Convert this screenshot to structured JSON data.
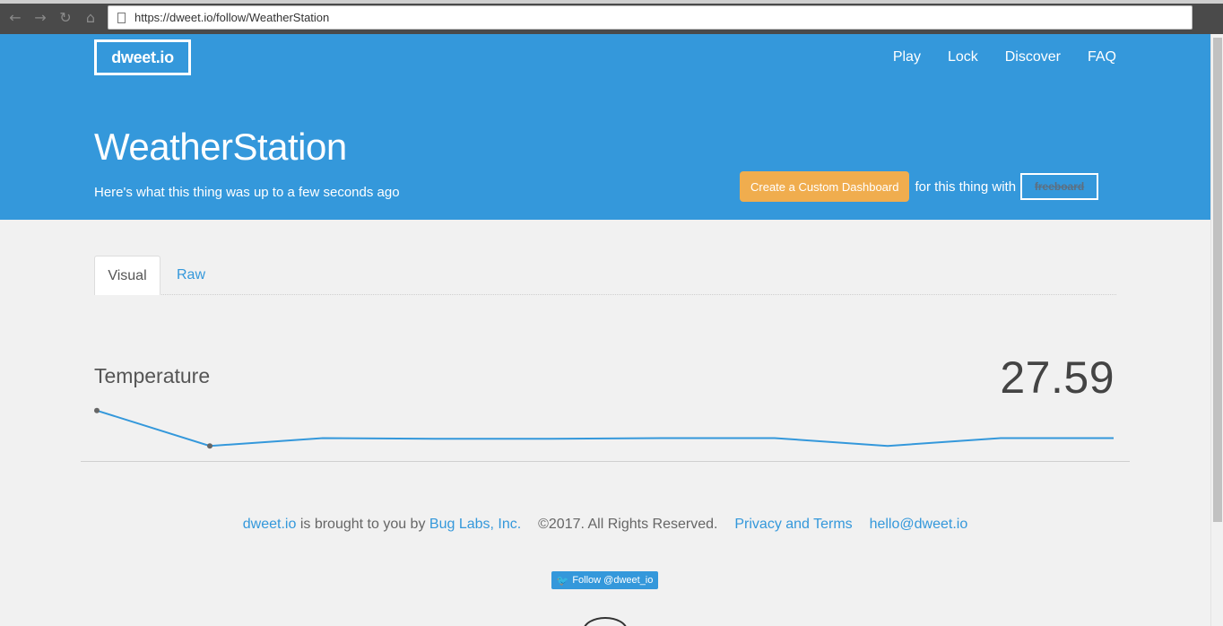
{
  "browser": {
    "url": "https://dweet.io/follow/WeatherStation"
  },
  "header": {
    "logo": "dweet.io",
    "nav": [
      {
        "label": "Play"
      },
      {
        "label": "Lock"
      },
      {
        "label": "Discover"
      },
      {
        "label": "FAQ"
      }
    ],
    "title": "WeatherStation",
    "subtitle": "Here's what this thing was up to a few seconds ago",
    "dashboard_button": "Create a Custom Dashboard",
    "dashboard_with": "for this thing with",
    "freeboard_label": "freeboard"
  },
  "tabs": [
    {
      "label": "Visual",
      "active": true
    },
    {
      "label": "Raw",
      "active": false
    }
  ],
  "metric": {
    "label": "Temperature",
    "value": "27.59"
  },
  "chart_data": {
    "type": "line",
    "series": [
      {
        "values": [
          27.66,
          27.57,
          27.59,
          27.588,
          27.588,
          27.59,
          27.59,
          27.57,
          27.59,
          27.59
        ]
      }
    ],
    "ylim": [
      27.55,
      27.68
    ],
    "color": "#3498db"
  },
  "footer": {
    "brand_link": "dweet.io",
    "brought": "is brought to you by",
    "company_link": "Bug Labs, Inc.",
    "copyright": "©2017. All Rights Reserved.",
    "privacy_link": "Privacy and Terms",
    "email_link": "hello@dweet.io",
    "follow_button": "Follow @dweet_io"
  },
  "colors": {
    "primary": "#3498db",
    "accent": "#f0ad4e"
  }
}
